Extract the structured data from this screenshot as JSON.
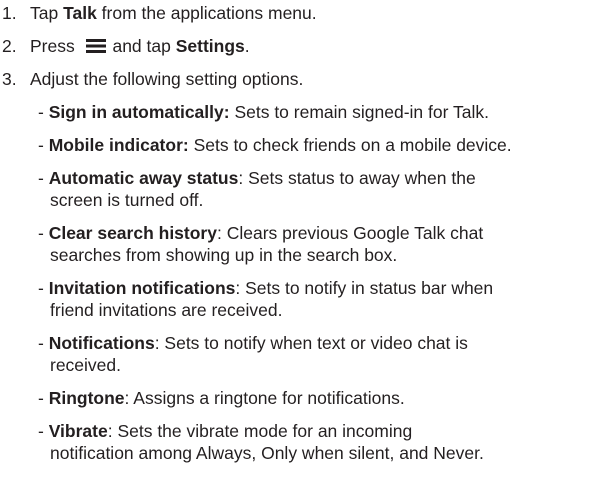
{
  "steps": [
    {
      "num": "1.",
      "pre": "Tap ",
      "bold": "Talk",
      "post": " from the applications menu."
    },
    {
      "num": "2.",
      "pre": "Press ",
      "mid": " and tap ",
      "bold": "Settings",
      "post": "."
    },
    {
      "num": "3.",
      "text": "Adjust the following setting options."
    }
  ],
  "menu_icon": "menu-icon",
  "options": [
    {
      "dash": "- ",
      "bold": "Sign in automatically:",
      "text": " Sets to remain signed-in for Talk.",
      "cont": ""
    },
    {
      "dash": "- ",
      "bold": "Mobile indicator:",
      "text": " Sets to check friends on a mobile device.",
      "cont": ""
    },
    {
      "dash": "- ",
      "bold": "Automatic away status",
      "text": ": Sets status to away when the",
      "cont": "screen is turned off."
    },
    {
      "dash": "- ",
      "bold": "Clear search history",
      "text": ": Clears previous Google Talk chat",
      "cont": "searches from showing up in the search box."
    },
    {
      "dash": "- ",
      "bold": "Invitation notifications",
      "text": ": Sets to notify in status bar when",
      "cont": "friend invitations are received."
    },
    {
      "dash": "- ",
      "bold": "Notifications",
      "text": ": Sets to notify when text or video chat is",
      "cont": "received."
    },
    {
      "dash": "- ",
      "bold": "Ringtone",
      "text": ": Assigns a ringtone for notifications.",
      "cont": ""
    },
    {
      "dash": "- ",
      "bold": "Vibrate",
      "text": ": Sets the vibrate mode for an incoming",
      "cont": "notification among Always, Only when silent, and Never."
    }
  ]
}
